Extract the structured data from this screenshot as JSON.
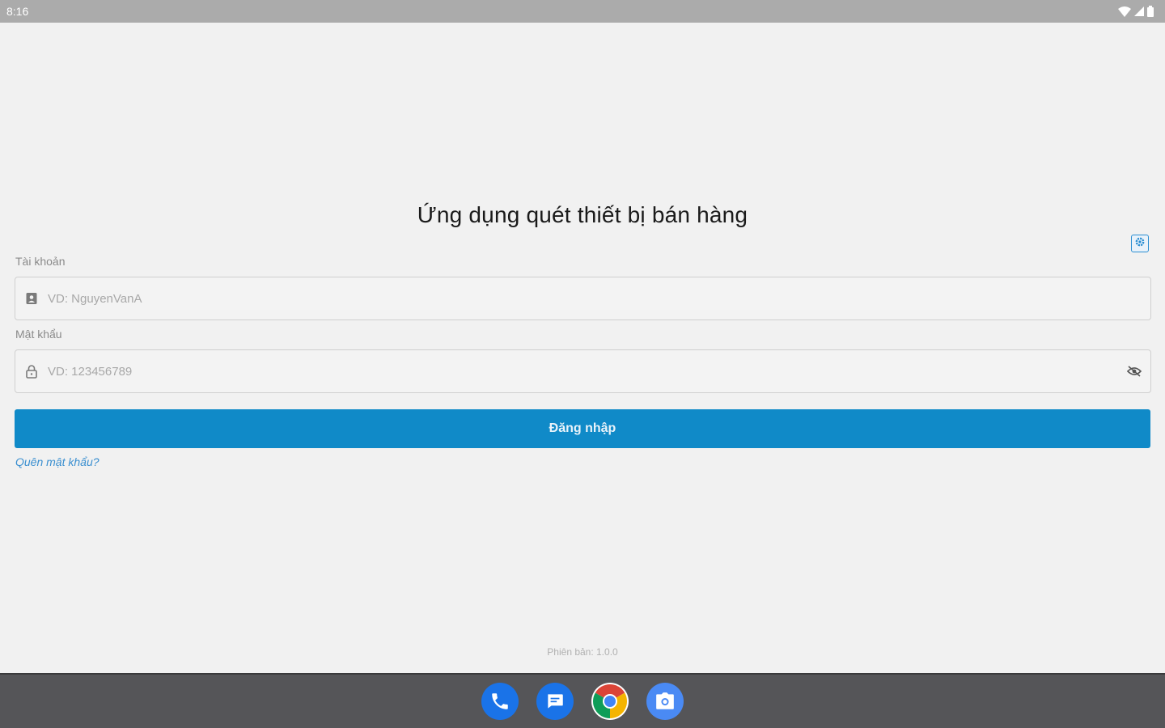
{
  "status_bar": {
    "time": "8:16",
    "icons": [
      "wifi-icon",
      "signal-icon",
      "battery-icon"
    ]
  },
  "app": {
    "title": "Ứng dụng quét thiết bị bán hàng",
    "settings_icon": "settings-icon"
  },
  "form": {
    "username": {
      "label": "Tài khoản",
      "placeholder": "VD: NguyenVanA",
      "value": "",
      "icon": "contact-card-icon"
    },
    "password": {
      "label": "Mật khẩu",
      "placeholder": "VD: 123456789",
      "value": "",
      "icon": "lock-icon",
      "toggle_icon": "eye-off-icon"
    },
    "login_label": "Đăng nhập",
    "forgot_label": "Quên mật khẩu?"
  },
  "footer": {
    "version": "Phiên bản: 1.0.0"
  },
  "dock": {
    "apps": [
      "phone-icon",
      "messages-icon",
      "chrome-icon",
      "camera-icon"
    ]
  },
  "colors": {
    "primary": "#108ac8",
    "link": "#3a8fd0",
    "background": "#f1f1f1"
  }
}
